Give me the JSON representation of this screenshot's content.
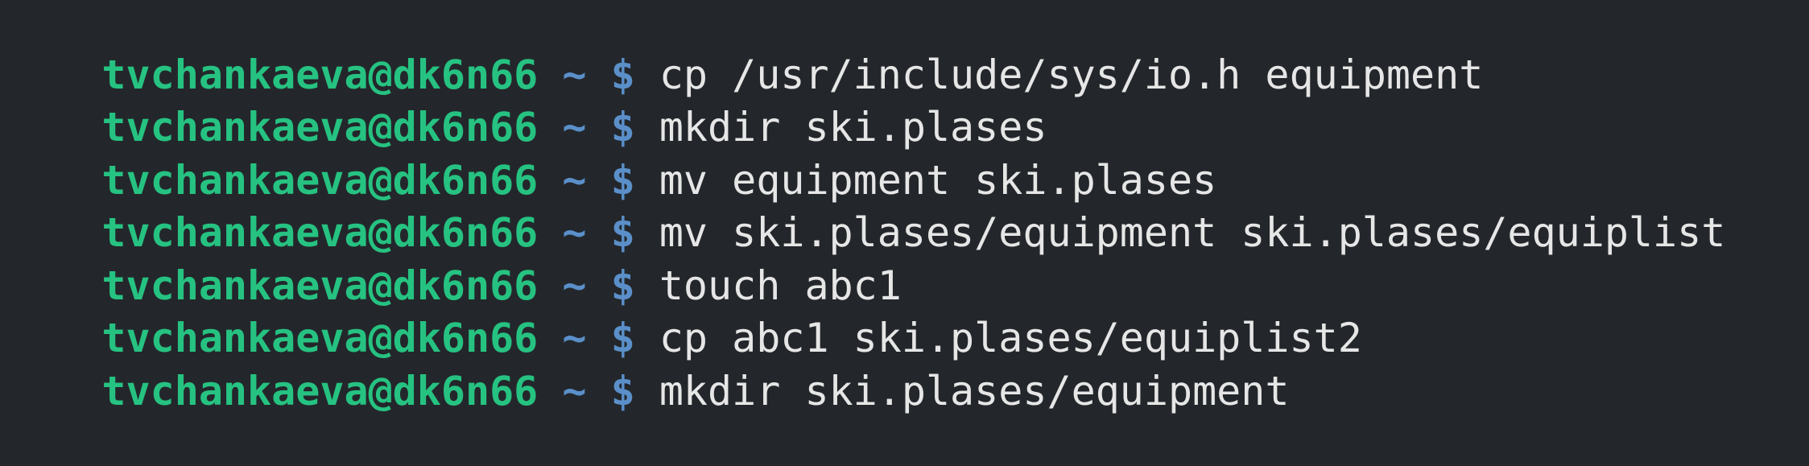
{
  "terminal": {
    "prompt_user": "tvchankaeva@dk6n66",
    "prompt_dir": "~",
    "prompt_symbol": "$",
    "colors": {
      "background": "#23272b",
      "user": "#26c281",
      "path": "#5a8fc9",
      "text": "#e6e6e6"
    },
    "lines": [
      {
        "command": "cp /usr/include/sys/io.h equipment"
      },
      {
        "command": "mkdir ski.plases"
      },
      {
        "command": "mv equipment ski.plases"
      },
      {
        "command": "mv ski.plases/equipment ski.plases/equiplist"
      },
      {
        "command": "touch abc1"
      },
      {
        "command": "cp abc1 ski.plases/equiplist2"
      },
      {
        "command": "mkdir ski.plases/equipment"
      }
    ]
  }
}
